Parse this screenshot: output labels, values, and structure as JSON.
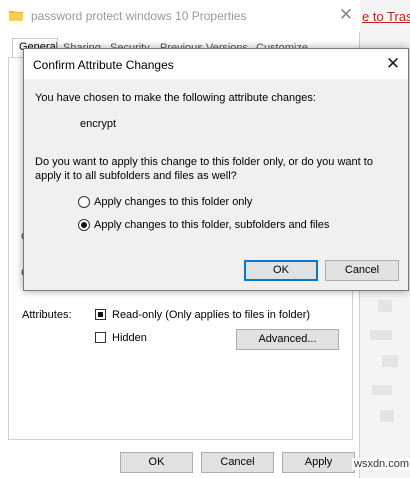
{
  "background": {
    "link_text": "e to Tras",
    "watermark": "wsxdn.com"
  },
  "properties_window": {
    "title": "password protect windows 10 Properties",
    "tabs": [
      {
        "label": "General"
      },
      {
        "label": "Sharing"
      },
      {
        "label": "Security"
      },
      {
        "label": "Previous Versions"
      },
      {
        "label": "Customize"
      }
    ],
    "partial_letters": [
      "C",
      "C"
    ],
    "attributes_label": "Attributes:",
    "readonly_label": "Read-only (Only applies to files in folder)",
    "readonly_checked": true,
    "hidden_label": "Hidden",
    "hidden_checked": false,
    "advanced_button": "Advanced...",
    "ok_button": "OK",
    "cancel_button": "Cancel",
    "apply_button": "Apply"
  },
  "dialog": {
    "title": "Confirm Attribute Changes",
    "message": "You have chosen to make the following attribute changes:",
    "change": "encrypt",
    "question_line1": "Do you want to apply this change to this folder only, or do you want to",
    "question_line2": "apply it to all subfolders and files as well?",
    "option_folder_only": "Apply changes to this folder only",
    "option_all": "Apply changes to this folder, subfolders and files",
    "selected_option": "option_all",
    "ok_button": "OK",
    "cancel_button": "Cancel"
  },
  "colors": {
    "accent": "#0078d7",
    "link_red": "#c4211e",
    "button_face": "#e1e1e1"
  }
}
